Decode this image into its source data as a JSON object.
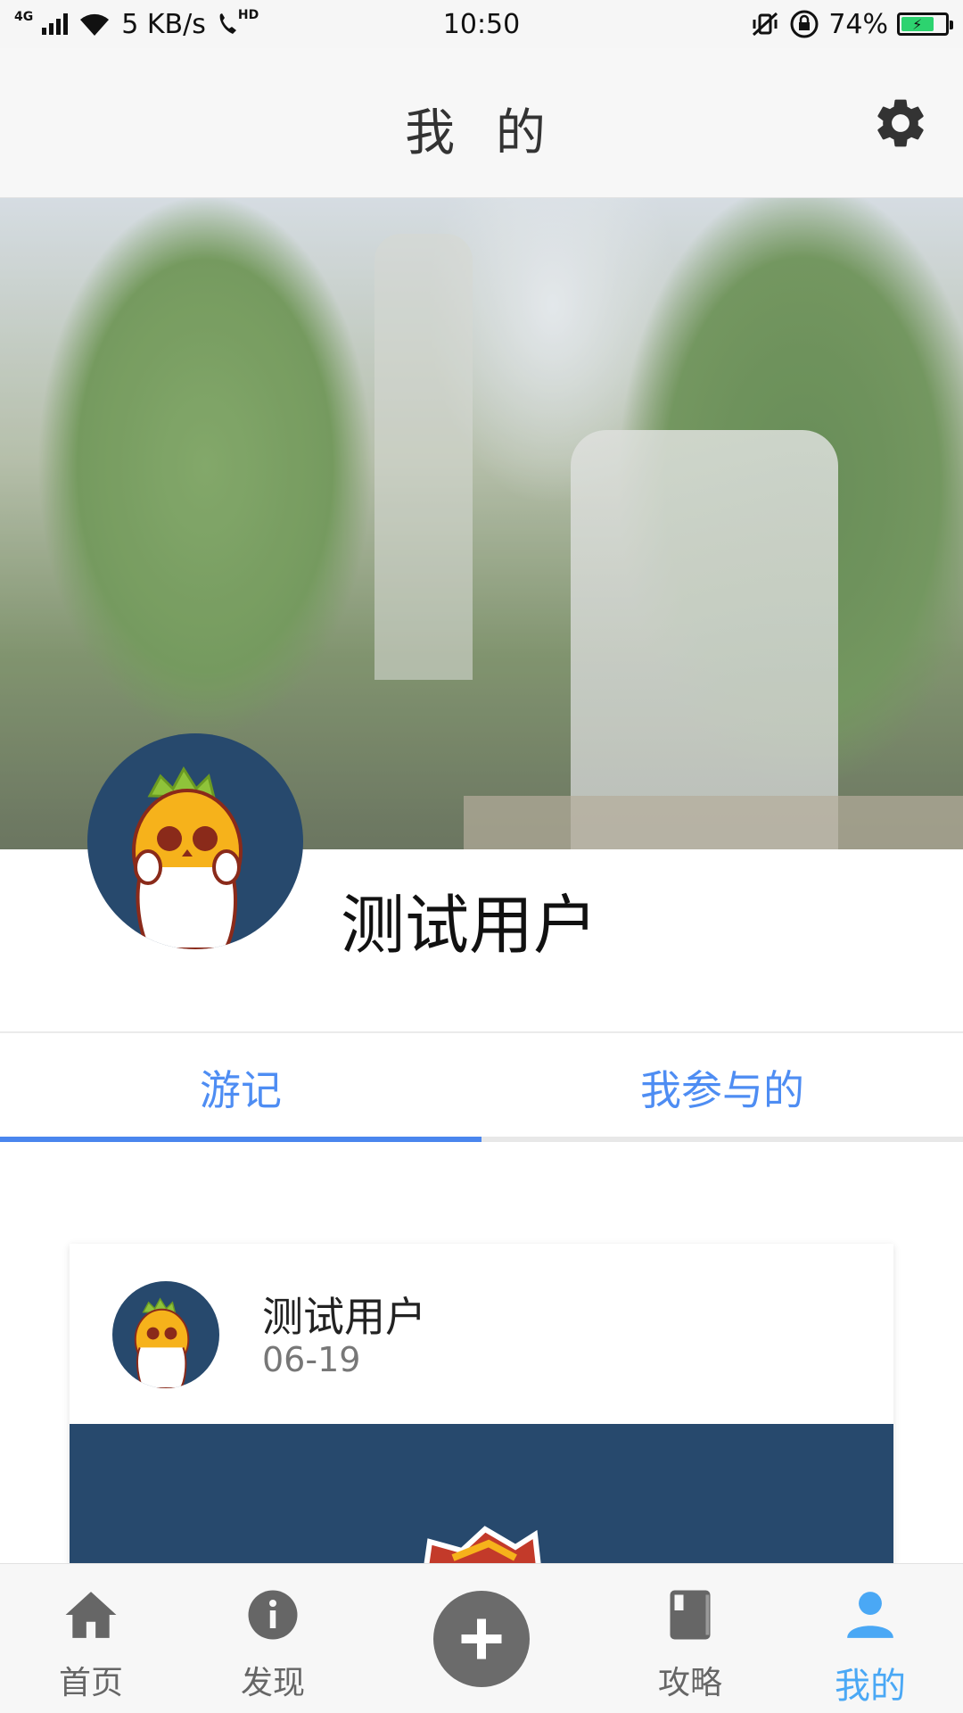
{
  "status_bar": {
    "network": "4G",
    "speed": "5 KB/s",
    "hd": "HD",
    "time": "10:50",
    "battery_percent": "74%",
    "battery_level": 0.74,
    "battery_color": "#2dd36f"
  },
  "header": {
    "title": "我 的",
    "settings_icon": "gear-icon"
  },
  "profile": {
    "username": "测试用户",
    "avatar_icon": "pineapple-avatar"
  },
  "tabs": [
    {
      "label": "游记",
      "active": true
    },
    {
      "label": "我参与的",
      "active": false
    }
  ],
  "post_card": {
    "author": "测试用户",
    "date": "06-19"
  },
  "bottom_nav": {
    "items": [
      {
        "label": "首页",
        "icon": "home-icon"
      },
      {
        "label": "发现",
        "icon": "info-icon"
      },
      {
        "label": "",
        "icon": "plus-icon"
      },
      {
        "label": "攻略",
        "icon": "book-icon"
      },
      {
        "label": "我的",
        "icon": "person-icon",
        "active": true
      }
    ]
  },
  "colors": {
    "accent": "#4a86ee",
    "active_nav": "#4aa8f5",
    "avatar_bg": "#27496d"
  }
}
